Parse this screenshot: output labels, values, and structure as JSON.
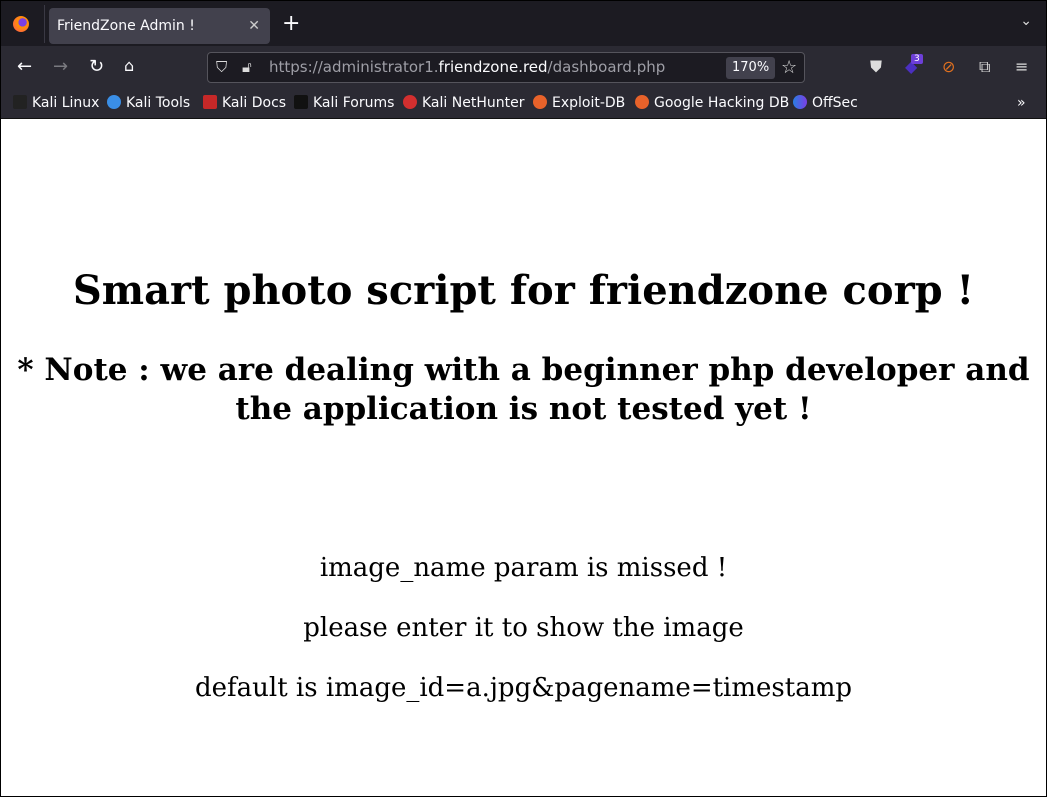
{
  "browser": {
    "tab_title": "FriendZone Admin !",
    "url_prefix": "https://administrator1.",
    "url_domain": "friendzone.red",
    "url_path": "/dashboard.php",
    "zoom": "170%",
    "extension_badge": "3",
    "bookmarks": [
      "Kali Linux",
      "Kali Tools",
      "Kali Docs",
      "Kali Forums",
      "Kali NetHunter",
      "Exploit-DB",
      "Google Hacking DB",
      "OffSec"
    ]
  },
  "page": {
    "title": "Smart photo script for friendzone corp !",
    "note": "* Note : we are dealing with a beginner php developer and the application is not tested yet !",
    "messages": [
      "image_name param is missed !",
      "please enter it to show the image",
      "default is image_id=a.jpg&pagename=timestamp"
    ]
  }
}
